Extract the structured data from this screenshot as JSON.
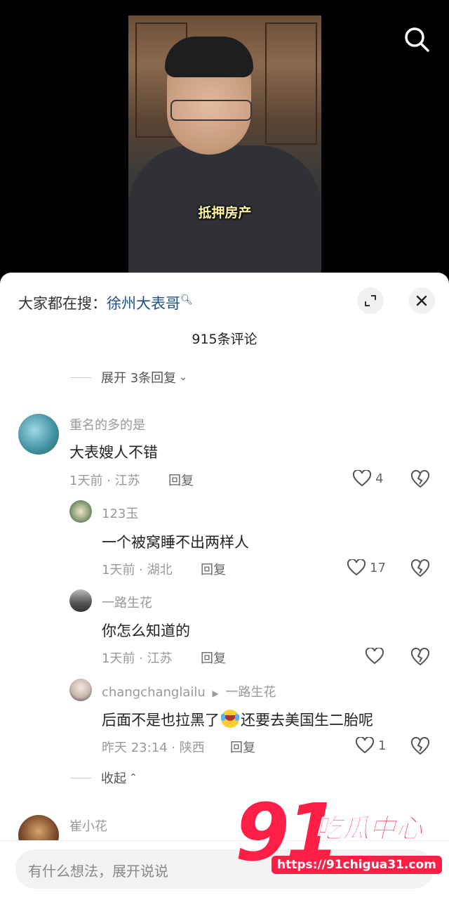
{
  "video": {
    "subtitle": "抵押房产"
  },
  "sheet": {
    "search_prefix": "大家都在搜：",
    "search_link": "徐州大表哥",
    "comment_count": "915条评论",
    "expand_replies": "展开 3条回复",
    "collapse": "收起"
  },
  "comments": [
    {
      "user": "重名的多的是",
      "text": "大表嫂人不错",
      "meta": "1天前 · 江苏",
      "reply": "回复",
      "likes": "4"
    },
    {
      "user": "123玉",
      "text": "一个被窝睡不出两样人",
      "meta": "1天前 · 湖北",
      "reply": "回复",
      "likes": "17"
    },
    {
      "user": "一路生花",
      "text": "你怎么知道的",
      "meta": "1天前 · 江苏",
      "reply": "回复",
      "likes": ""
    },
    {
      "user": "changchanglailu",
      "reply_to": "一路生花",
      "text_before": "后面不是也拉黑了",
      "text_after": "还要去美国生二胎呢",
      "meta": "昨天 23:14 · 陕西",
      "reply": "回复",
      "likes": "1"
    },
    {
      "user": "崔小花"
    }
  ],
  "input": {
    "placeholder": "有什么想法，展开说说"
  },
  "watermark": {
    "number": "91",
    "brand": "吃瓜中心",
    "url": "https://91chigua31.com"
  },
  "icons": [
    "search-icon",
    "expand-icon",
    "close-icon",
    "chevron-down-icon",
    "chevron-up-icon",
    "heart-icon",
    "broken-heart-icon",
    "laugh-cry-emoji"
  ]
}
